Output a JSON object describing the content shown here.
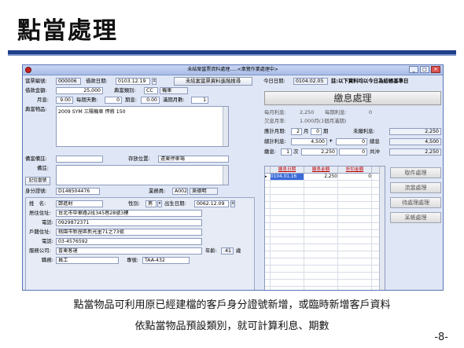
{
  "slide": {
    "title": "點當處理",
    "caption_1": "點當物品可利用原已經建檔的客戶身分證號新增，或臨時新增客戶資料",
    "caption_2": "依點當物品預設類別，就可計算利息、期數",
    "page_number": "-8-"
  },
  "window": {
    "title": "未結案當票資料處理.....<衆覽作業處理中>",
    "btn_min": "_",
    "btn_max": "□",
    "btn_close": "✕"
  },
  "form": {
    "ticket_no_label": "當票編號:",
    "ticket_no": "000006",
    "loan_date_label": "借款日期:",
    "loan_date": "0103.12.19",
    "unfinished_search_btn": "未結案當票資料進階搜尋",
    "today_label": "今日日期:",
    "today": "0104.02.05",
    "today_note": "註:以下資料均以今日為結帳基準日",
    "loan_amount_label": "借款金額:",
    "loan_amount": "25,000",
    "category_label": "典當類別:",
    "category_code": "CC",
    "category_name": "機車",
    "monthly_rate_label": "月息:",
    "monthly_rate": "9.00",
    "days_per_period_label": "每期天數:",
    "days_per_period": "0",
    "period_rate_label": "期息:",
    "period_rate": "0.00",
    "full_months_label": "滿期月數:",
    "full_months": "1",
    "item_label": "典當物品:",
    "item_text": "2009 SYM 三陽機車 悍將 150",
    "note_label": "備當備註:",
    "storage_label": "存放位置:",
    "storage_value": "遠東停車場",
    "remark_label": "備註:",
    "record_btn": "記住當號",
    "id_label": "身分證號:",
    "id_no": "D148504476",
    "clerk_label": "業務員:",
    "clerk_code": "A002",
    "clerk_name": "吳德明",
    "name_label": "姓　名:",
    "name_value": "鄭進財",
    "gender_label": "性別:",
    "gender_value": "男",
    "birth_label": "出生日期:",
    "birth_value": "0062.12.09",
    "address_label": "居住住址:",
    "address_value": "台北市中華路2段345巷28號3樓",
    "phone_label": "電話:",
    "phone_value": "0929872371",
    "reg_address_label": "戶籍住址:",
    "reg_address_value": "桃園市新屋區新光里71之73號",
    "reg_phone_label": "電話:",
    "reg_phone_value": "03-4576592",
    "company_label": "服務公司:",
    "company_value": "普東客運",
    "age_label": "年齡:",
    "age_value": "41",
    "age_unit": "歲",
    "job_label": "職務:",
    "job_value": "員工",
    "dept_label": "專號:",
    "dept_value": "TAA-432"
  },
  "interest": {
    "title_btn": "繳息處理",
    "monthly_interest_label": "每月利息:",
    "monthly_interest": "2,250",
    "period_interest_label": "每期利息:",
    "period_interest": "0",
    "overdue_label": "欠息月率:",
    "overdue_value": "1.000月(1個月滿期)",
    "calc_months_label": "應計月期:",
    "calc_months": "2",
    "month_unit": "月",
    "calc_periods": "0",
    "period_unit": "期",
    "unpaid_label": "未繳利息:",
    "unpaid_value": "2,250",
    "total_interest_label": "總計利息:",
    "total_interest": "4,500",
    "plus": "+",
    "total_plus": "0",
    "total_label": "總息",
    "total_value": "4,500",
    "pay_label": "繳息:",
    "pay_count": "1",
    "pay_unit": "次",
    "pay_amount": "2,250",
    "pay_extra": "0",
    "offset_label": "共沖",
    "offset_value": "2,250"
  },
  "grid": {
    "headers": [
      "繳息日期",
      "繳息金額",
      "折扣金額"
    ],
    "rows": [
      {
        "date": "0104.01.16",
        "amount": "2,250",
        "discount": "0"
      }
    ]
  },
  "side_buttons": [
    "取件處理",
    "流當處理",
    "待處理處理",
    "呆帳處理"
  ],
  "colors": {
    "accent": "#1f3f88",
    "window_bg": "#dfe6f5",
    "selected": "#3a6bd8"
  }
}
